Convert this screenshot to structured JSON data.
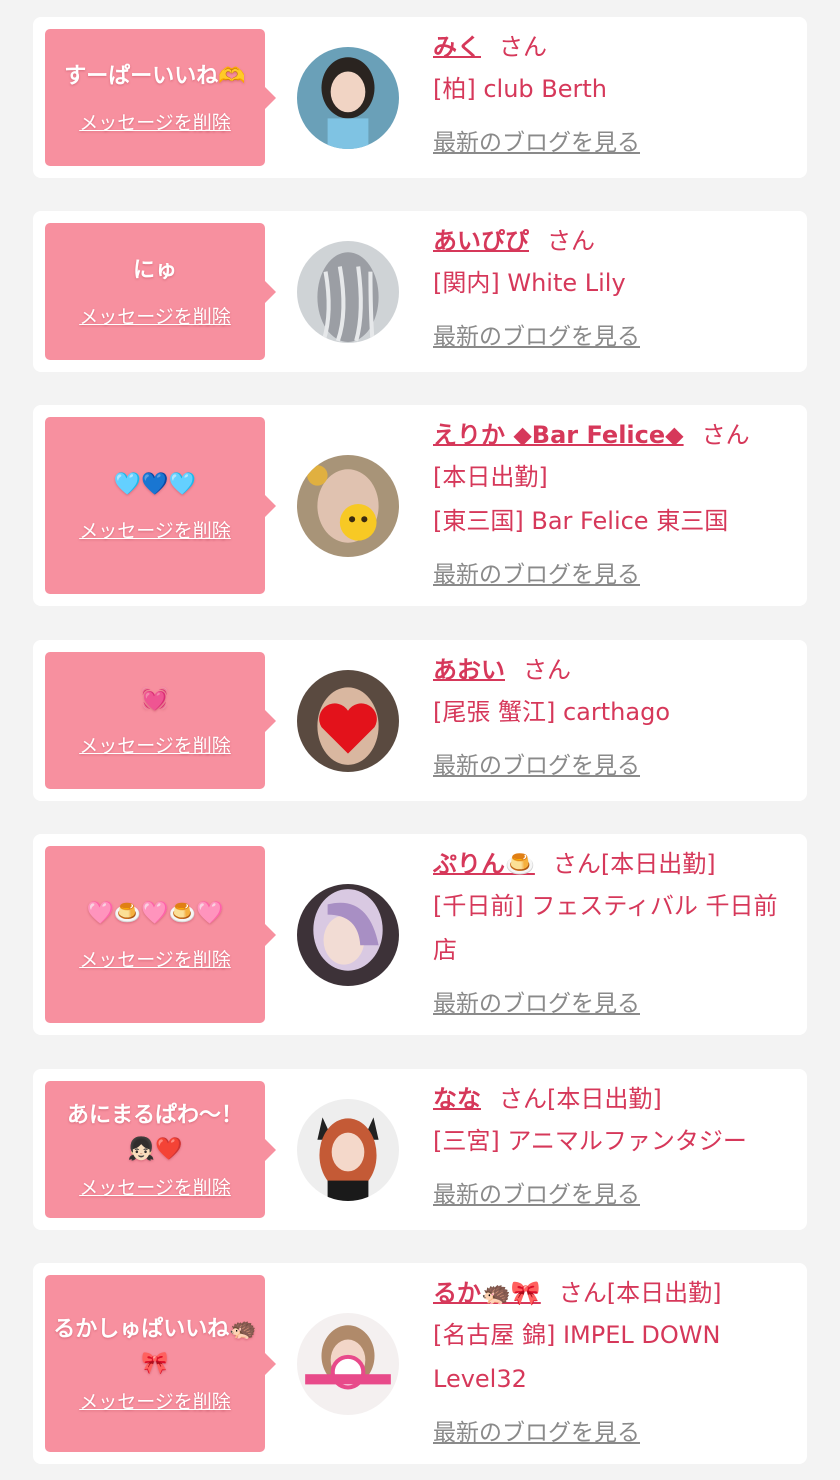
{
  "delete_label": "メッセージを削除",
  "blog_label": "最新のブログを見る",
  "colors": {
    "background": "#f3f3f3",
    "bubble": "#f7909f",
    "accent": "#d6385a",
    "link_gray": "#8a8a8a"
  },
  "items": [
    {
      "message": "すーぱーいいね🫶",
      "name": "みく",
      "honorific": "さん",
      "status": "",
      "shop": "[柏] club Berth"
    },
    {
      "message": "にゅ",
      "name": "あいぴぴ",
      "honorific": "さん",
      "status": "",
      "shop": "[関内] White Lily"
    },
    {
      "message": "🩵💙🩵",
      "name": "えりか ◆Bar Felice◆",
      "honorific": "さん",
      "status": "[本日出勤]",
      "shop": "[東三国] Bar Felice 東三国"
    },
    {
      "message": "💓",
      "name": "あおい",
      "honorific": "さん",
      "status": "",
      "shop": "[尾張 蟹江] carthago"
    },
    {
      "message": "🩷🍮🩷🍮🩷",
      "name": "ぷりん🍮",
      "honorific": "さん",
      "status": "[本日出勤]",
      "shop": "[千日前] フェスティバル 千日前店"
    },
    {
      "message": "あにまるぱわ〜！👧🏻❤️",
      "name": "なな",
      "honorific": "さん",
      "status": "[本日出勤]",
      "shop": "[三宮] アニマルファンタジー"
    },
    {
      "message": "るかしゅぱいいね🦔🎀",
      "name": "るか🦔🎀",
      "honorific": "さん",
      "status": "[本日出勤]",
      "shop": "[名古屋 錦] IMPEL DOWN Level32"
    }
  ]
}
